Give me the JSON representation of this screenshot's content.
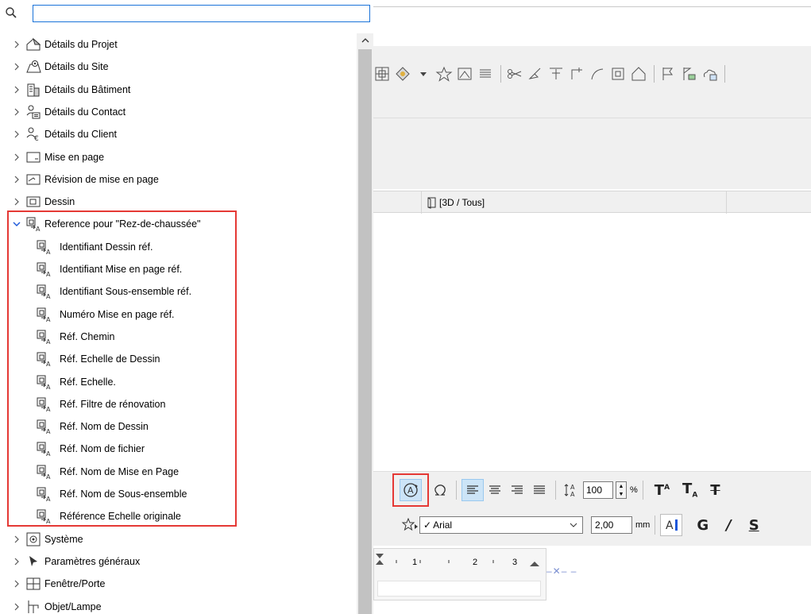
{
  "search": {
    "value": "",
    "placeholder": ""
  },
  "tree": {
    "items": [
      {
        "label": "Détails du Projet",
        "icon": "project-icon"
      },
      {
        "label": "Détails du Site",
        "icon": "site-icon"
      },
      {
        "label": "Détails du Bâtiment",
        "icon": "building-icon"
      },
      {
        "label": "Détails du Contact",
        "icon": "contact-icon"
      },
      {
        "label": "Détails du Client",
        "icon": "client-icon"
      },
      {
        "label": "Mise en page",
        "icon": "layout-icon"
      },
      {
        "label": "Révision de mise en page",
        "icon": "layout-revision-icon"
      },
      {
        "label": "Dessin",
        "icon": "drawing-icon"
      },
      {
        "label": "Reference pour \"Rez-de-chaussée\"",
        "icon": "reference-icon",
        "expanded": true
      },
      {
        "label": "Système",
        "icon": "system-icon"
      },
      {
        "label": "Paramètres généraux",
        "icon": "general-params-icon"
      },
      {
        "label": "Fenêtre/Porte",
        "icon": "window-door-icon"
      },
      {
        "label": "Objet/Lampe",
        "icon": "object-lamp-icon"
      }
    ],
    "reference_children": [
      "Identifiant Dessin réf.",
      "Identifiant Mise en page réf.",
      "Identifiant Sous-ensemble réf.",
      "Numéro Mise en page réf.",
      "Réf. Chemin",
      "Réf. Echelle de Dessin",
      "Réf. Echelle.",
      "Réf. Filtre de rénovation",
      "Réf. Nom de Dessin",
      "Réf. Nom de fichier",
      "Réf. Nom de Mise en Page",
      "Réf. Nom de Sous-ensemble",
      "Référence Echelle originale"
    ]
  },
  "view": {
    "label": "[3D / Tous]"
  },
  "format": {
    "size_value": "100",
    "size_unit": "%",
    "font_name": "Arial",
    "font_size": "2,00",
    "font_unit": "mm",
    "bold_label": "G",
    "italic_label": "/",
    "underline_label": "S"
  },
  "ruler": {
    "ticks": [
      "1",
      "2",
      "3"
    ]
  },
  "colors": {
    "accent": "#1a73d9",
    "highlight": "#e53935",
    "selected": "#cce4f7"
  }
}
